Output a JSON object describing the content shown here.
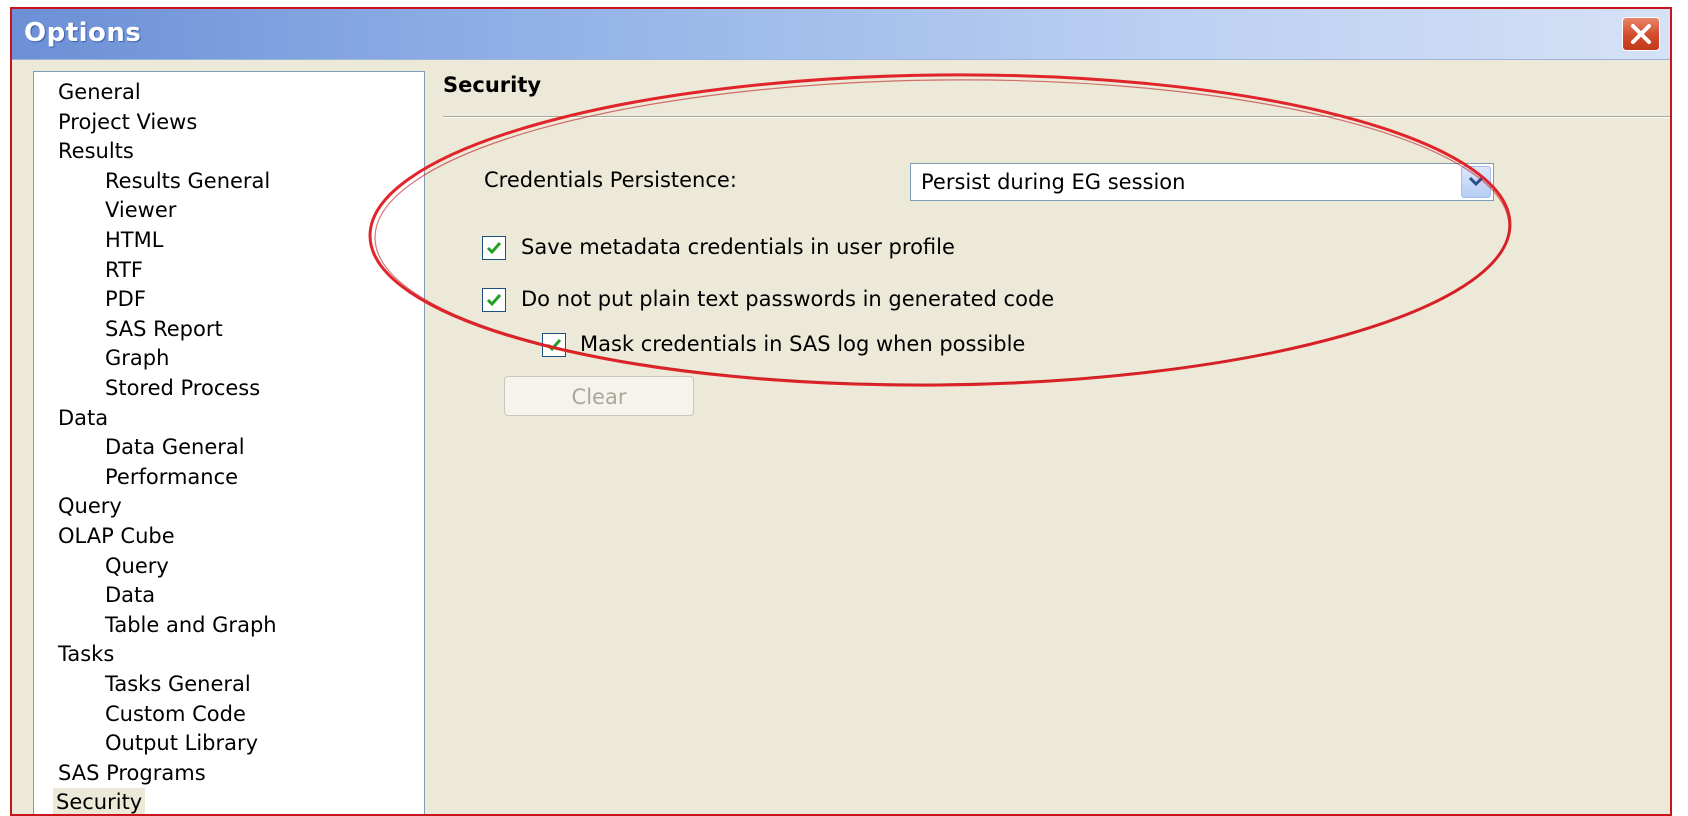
{
  "window": {
    "title": "Options"
  },
  "tree": {
    "items": [
      {
        "label": "General",
        "level": 0
      },
      {
        "label": "Project Views",
        "level": 0
      },
      {
        "label": "Results",
        "level": 0
      },
      {
        "label": "Results General",
        "level": 1
      },
      {
        "label": "Viewer",
        "level": 1
      },
      {
        "label": "HTML",
        "level": 1
      },
      {
        "label": "RTF",
        "level": 1
      },
      {
        "label": "PDF",
        "level": 1
      },
      {
        "label": "SAS Report",
        "level": 1
      },
      {
        "label": "Graph",
        "level": 1
      },
      {
        "label": "Stored Process",
        "level": 1
      },
      {
        "label": "Data",
        "level": 0
      },
      {
        "label": "Data General",
        "level": 1
      },
      {
        "label": "Performance",
        "level": 1
      },
      {
        "label": "Query",
        "level": 0
      },
      {
        "label": "OLAP Cube",
        "level": 0
      },
      {
        "label": "Query",
        "level": 1
      },
      {
        "label": "Data",
        "level": 1
      },
      {
        "label": "Table and Graph",
        "level": 1
      },
      {
        "label": "Tasks",
        "level": 0
      },
      {
        "label": "Tasks General",
        "level": 1
      },
      {
        "label": "Custom Code",
        "level": 1
      },
      {
        "label": "Output Library",
        "level": 1
      },
      {
        "label": "SAS Programs",
        "level": 0
      },
      {
        "label": "Security",
        "level": 0,
        "selected": true
      }
    ]
  },
  "security": {
    "title": "Security",
    "credentials_label": "Credentials Persistence:",
    "credentials_value": "Persist during EG session",
    "save_metadata_label": "Save metadata credentials in user profile",
    "save_metadata_checked": true,
    "no_plaintext_label": "Do not put plain text passwords in generated code",
    "no_plaintext_checked": true,
    "mask_credentials_label": "Mask credentials in SAS log when possible",
    "mask_credentials_checked": true,
    "clear_label": "Clear",
    "clear_enabled": false
  },
  "colors": {
    "titlebar_start": "#6c8fd6",
    "panel_bg": "#ece9d8",
    "highlight_ellipse": "#e0242a",
    "checkmark": "#21a121"
  },
  "icons": {
    "close": "close-icon",
    "dropdown": "chevron-down-icon",
    "check": "checkmark-icon"
  }
}
